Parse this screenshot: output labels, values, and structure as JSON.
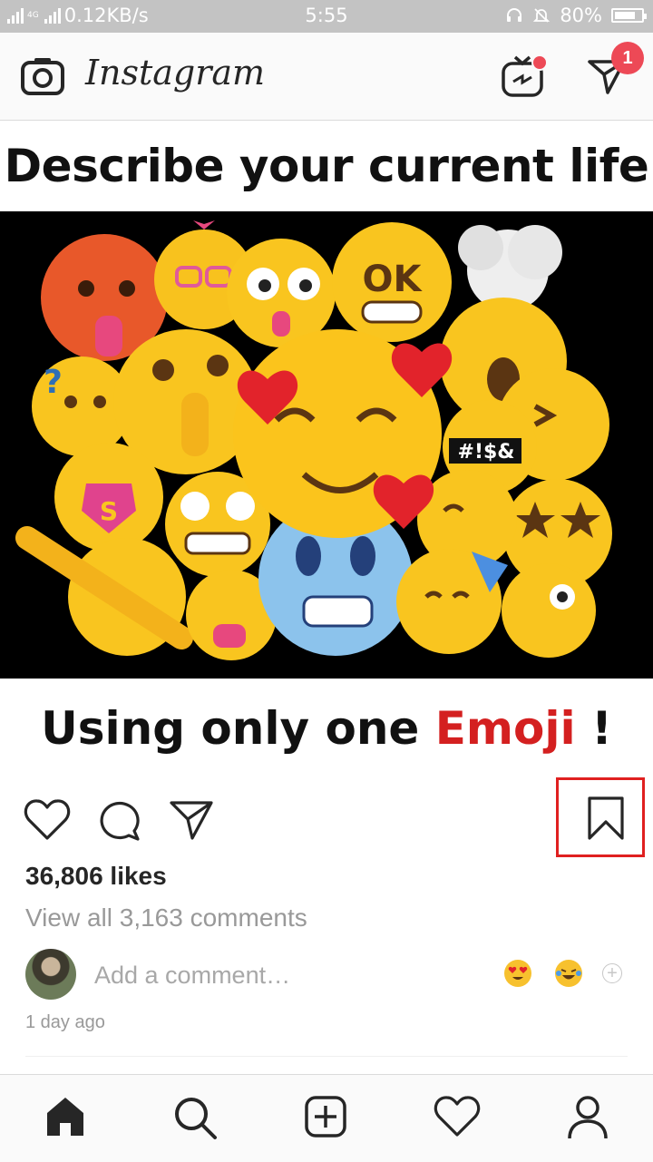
{
  "status": {
    "network_type": "4G",
    "speed": "0.12KB/s",
    "time": "5:55",
    "battery": "80%",
    "battery_level": 0.8
  },
  "header": {
    "logo": "Instagram",
    "camera_icon": "camera-icon",
    "igtv_icon": "igtv-icon",
    "direct_icon": "direct-message-icon",
    "direct_badge": "1"
  },
  "post": {
    "headline": "Describe your current life",
    "subline_prefix": "Using only one ",
    "subline_emph": "Emoji",
    "subline_suffix": " !",
    "emph_color": "#d42020",
    "likes": "36,806 likes",
    "view_comments": "View all 3,163 comments",
    "add_comment_placeholder": "Add a comment…",
    "quick_emojis": [
      "heart-eyes-emoji",
      "laughing-tears-emoji"
    ],
    "timestamp": "1 day ago",
    "highlight_color": "#e02020"
  },
  "tabs": [
    "home-icon",
    "search-icon",
    "new-post-icon",
    "activity-heart-icon",
    "profile-icon"
  ]
}
